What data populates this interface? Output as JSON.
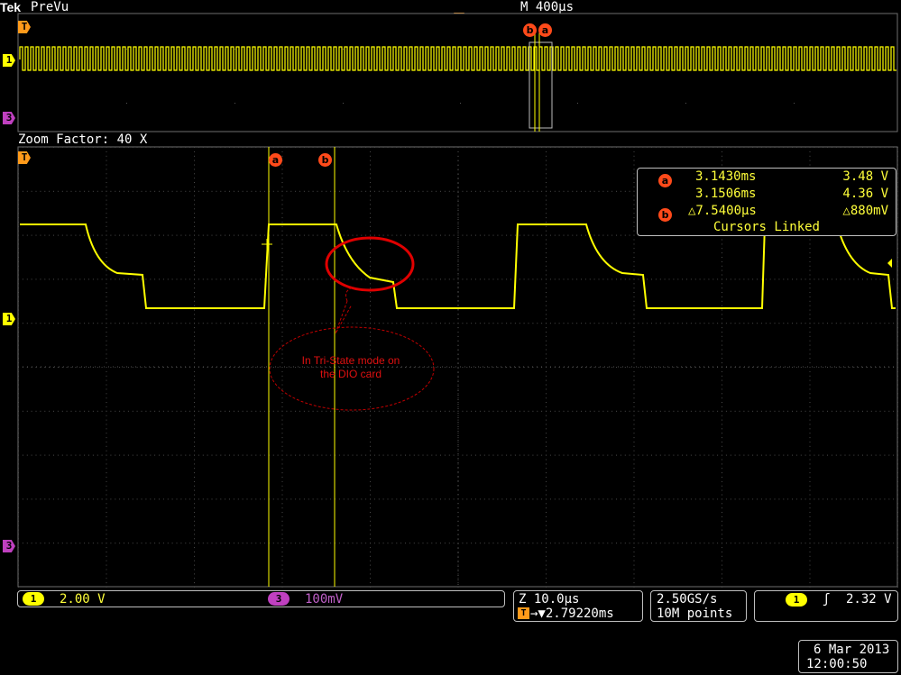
{
  "header": {
    "brand": "Tek",
    "mode": "PreVu",
    "timebase": "M 400µs"
  },
  "zoom": {
    "label": "Zoom Factor: 40 X"
  },
  "cursors": {
    "a_label": "a",
    "b_label": "b"
  },
  "markers": {
    "trigger": "T",
    "ch1": "1",
    "ch3": "3"
  },
  "measurements": {
    "row1": {
      "time": "3.1430ms",
      "volt": "3.48 V"
    },
    "row2": {
      "time": "3.1506ms",
      "volt": "4.36 V"
    },
    "row3": {
      "time": "△7.5400µs",
      "volt": "△880mV"
    },
    "linked": "Cursors Linked"
  },
  "annotation": {
    "text_line1": "In Tri-State mode on",
    "text_line2": "the DIO card"
  },
  "status": {
    "ch1_num": "1",
    "ch1_scale": "2.00 V",
    "ch3_num": "3",
    "ch3_scale": "100mV",
    "zoom_scale": "Z 10.0µs",
    "trig_pos": "→▼2.79220ms",
    "sample_rate": "2.50GS/s",
    "record_length": "10M points",
    "trig_ch": "1",
    "trig_slope": "ʃ",
    "trig_level": "2.32 V"
  },
  "datetime": {
    "date": "6 Mar  2013",
    "time": "12:00:50"
  },
  "colors": {
    "ch1": "#ffff00",
    "ch3": "#c040c0",
    "cursor_bubble": "#ff4a1a",
    "annotation": "#e00000"
  }
}
